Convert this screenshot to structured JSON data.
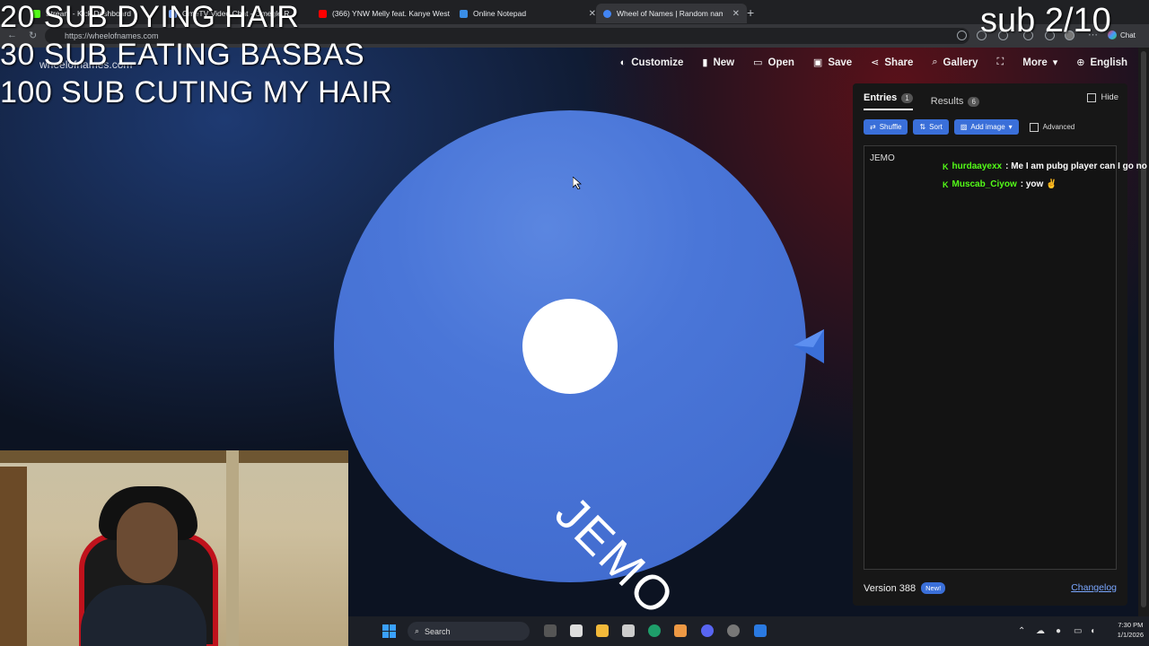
{
  "browser": {
    "tabs": [
      {
        "title": "Stream - Kick Dashboard",
        "favicon_color": "#53fc18"
      },
      {
        "title": "OmeTV Video Chat - Omegle R",
        "favicon_color": "#7aa7ff"
      },
      {
        "title": "(366) YNW Melly feat. Kanye West",
        "favicon_color": "#ff0000"
      },
      {
        "title": "Online Notepad",
        "favicon_color": "#3a8ee6"
      },
      {
        "title": "Wheel of Names | Random name",
        "favicon_color": "#4285f4"
      }
    ],
    "url": "https://wheelofnames.com",
    "chat_button": "Chat"
  },
  "app": {
    "site_name": "wheelofnames.com",
    "menu": [
      {
        "label": "Customize",
        "icon": "palette-icon"
      },
      {
        "label": "New",
        "icon": "file-icon"
      },
      {
        "label": "Open",
        "icon": "folder-icon"
      },
      {
        "label": "Save",
        "icon": "save-icon"
      },
      {
        "label": "Share",
        "icon": "share-icon"
      },
      {
        "label": "Gallery",
        "icon": "search-icon"
      },
      {
        "label": "",
        "icon": "fullscreen-icon"
      },
      {
        "label": "More",
        "icon": "chevron-down-icon"
      },
      {
        "label": "English",
        "icon": "globe-icon"
      }
    ],
    "wheel": {
      "entry": "JEMO",
      "color": "#4a76d8"
    },
    "panel": {
      "tabs": [
        {
          "label": "Entries",
          "count": "1"
        },
        {
          "label": "Results",
          "count": "6"
        }
      ],
      "hide_label": "Hide",
      "toolbar": {
        "shuffle": "Shuffle",
        "sort": "Sort",
        "add_image": "Add image",
        "advanced": "Advanced"
      },
      "entries_text": "JEMO",
      "version": "Version 388",
      "new_badge": "New!",
      "changelog": "Changelog"
    }
  },
  "chat": [
    {
      "user": "hurdaayexx",
      "message": ": Me I am pubg player can I go no"
    },
    {
      "user": "Muscab_Ciyow",
      "message": ": yow ✌"
    }
  ],
  "overlays": {
    "line1": "20 SUB DYING HAIR",
    "line2": "30 SUB EATING BASBAS",
    "line3": "100 SUB CUTING MY HAIR",
    "sub_counter": "sub 2/10"
  },
  "taskbar": {
    "search": "Search",
    "time": "7:30 PM",
    "date": "1/1/2026"
  }
}
